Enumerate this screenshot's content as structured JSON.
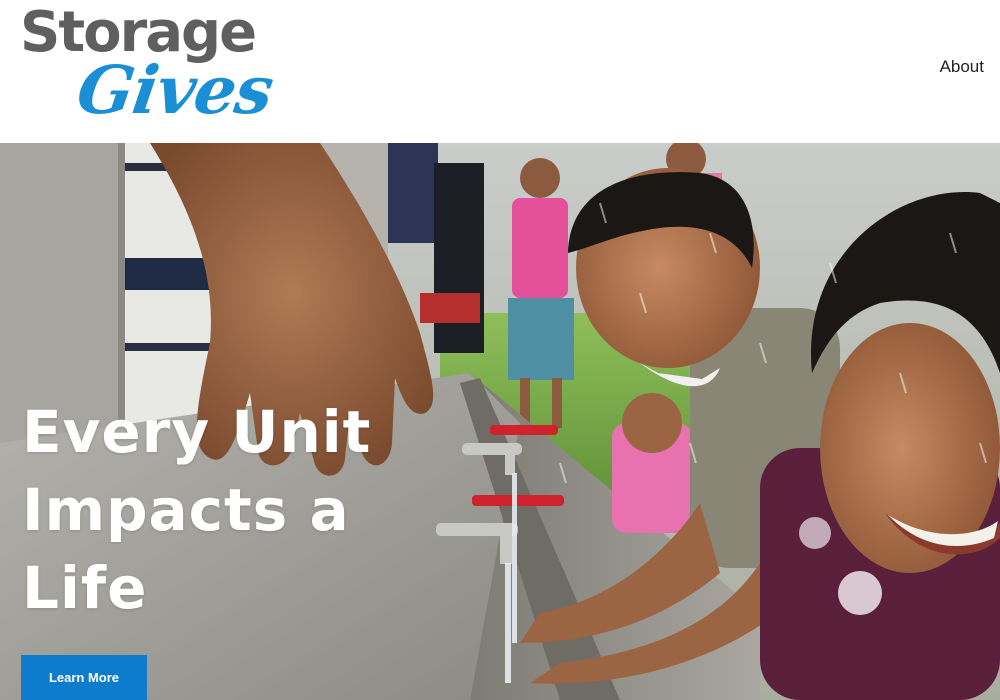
{
  "header": {
    "logo_line1": "Storage",
    "logo_line2": "Gives",
    "nav": [
      {
        "label": "About"
      }
    ]
  },
  "hero": {
    "headline_lines": [
      "Every Unit",
      "Impacts a",
      "Life"
    ],
    "cta_label": "Learn More"
  },
  "colors": {
    "brand_blue": "#1a8fd6",
    "logo_gray": "#5f5f5f",
    "cta_blue": "#0e7ccd"
  }
}
